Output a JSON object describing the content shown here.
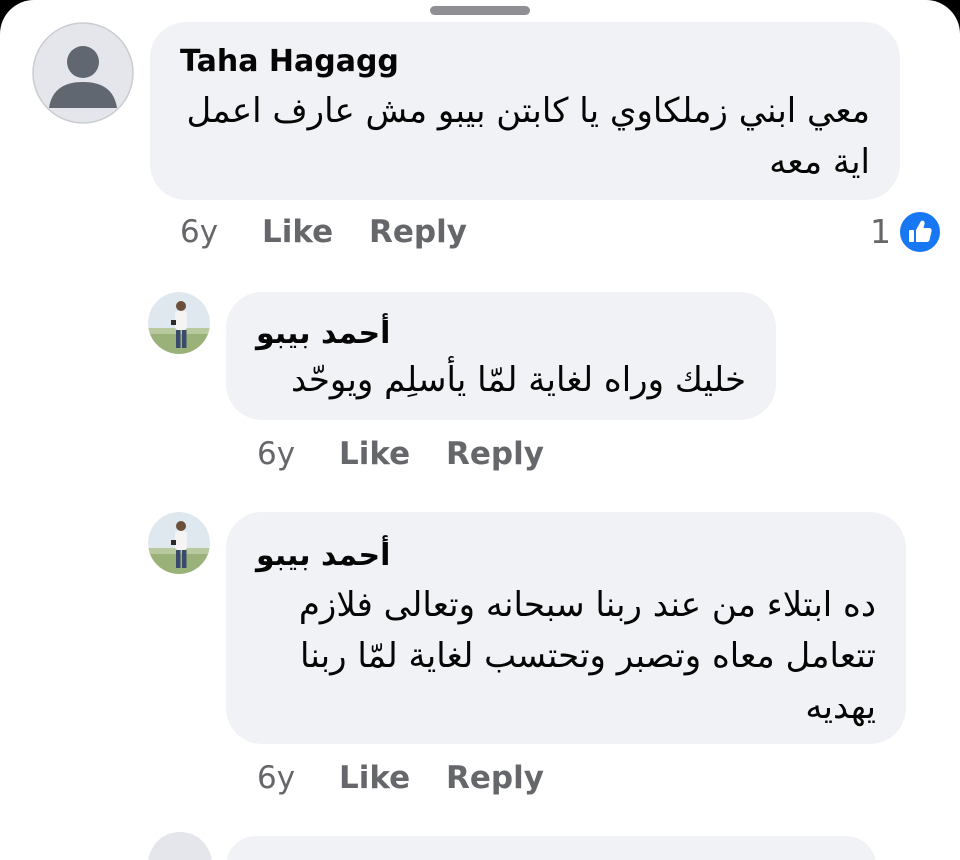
{
  "colors": {
    "bubble": "#f0f2f5",
    "meta_text": "#65676b",
    "primary_text": "#050505",
    "like_blue": "#1877f2"
  },
  "comments": [
    {
      "author": "Taha Hagagg",
      "lines": [
        "معي ابني زملكاوي يا كابتن بيبو مش عارف اعمل",
        "اية معه"
      ],
      "age": "6y",
      "like_label": "Like",
      "reply_label": "Reply",
      "reactions": {
        "count": "1",
        "icon": "like-icon"
      },
      "avatar": "default-profile-icon"
    },
    {
      "author": "أحمد بيبو",
      "lines": [
        "خليك وراه لغاية لمّا يأسلِم ويوحّد"
      ],
      "age": "6y",
      "like_label": "Like",
      "reply_label": "Reply",
      "avatar": "profile-photo"
    },
    {
      "author": "أحمد بيبو",
      "lines": [
        "ده ابتلاء من عند ربنا سبحانه وتعالى فلازم",
        "تتعامل معاه وتصبر وتحتسب لغاية لمّا ربنا",
        "يهديه"
      ],
      "age": "6y",
      "like_label": "Like",
      "reply_label": "Reply",
      "avatar": "profile-photo"
    }
  ]
}
